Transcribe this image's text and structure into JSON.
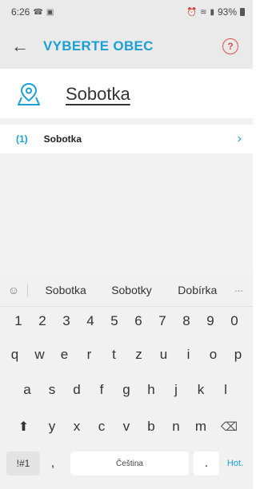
{
  "status": {
    "time": "6:26",
    "battery": "93%"
  },
  "appbar": {
    "back_icon": "←",
    "title": "VYBERTE OBEC",
    "help_icon": "?"
  },
  "search": {
    "value": "Sobotka"
  },
  "results": [
    {
      "number": "(1)",
      "name": "Sobotka",
      "chevron": "›"
    }
  ],
  "keyboard": {
    "suggestions": [
      "Sobotka",
      "Sobotky",
      "Dobírka"
    ],
    "emoji_icon": "☺",
    "more": "···",
    "row_numbers": [
      "1",
      "2",
      "3",
      "4",
      "5",
      "6",
      "7",
      "8",
      "9",
      "0"
    ],
    "row_top": [
      "q",
      "w",
      "e",
      "r",
      "t",
      "z",
      "u",
      "i",
      "o",
      "p"
    ],
    "row_mid": [
      "a",
      "s",
      "d",
      "f",
      "g",
      "h",
      "j",
      "k",
      "l"
    ],
    "row_bottom": [
      "y",
      "x",
      "c",
      "v",
      "b",
      "n",
      "m"
    ],
    "shift_icon": "⬆",
    "backspace_icon": "⌫",
    "symbols": "!#1",
    "comma": ",",
    "space_label": "Čeština",
    "dot": ".",
    "go_label": "Hot."
  }
}
